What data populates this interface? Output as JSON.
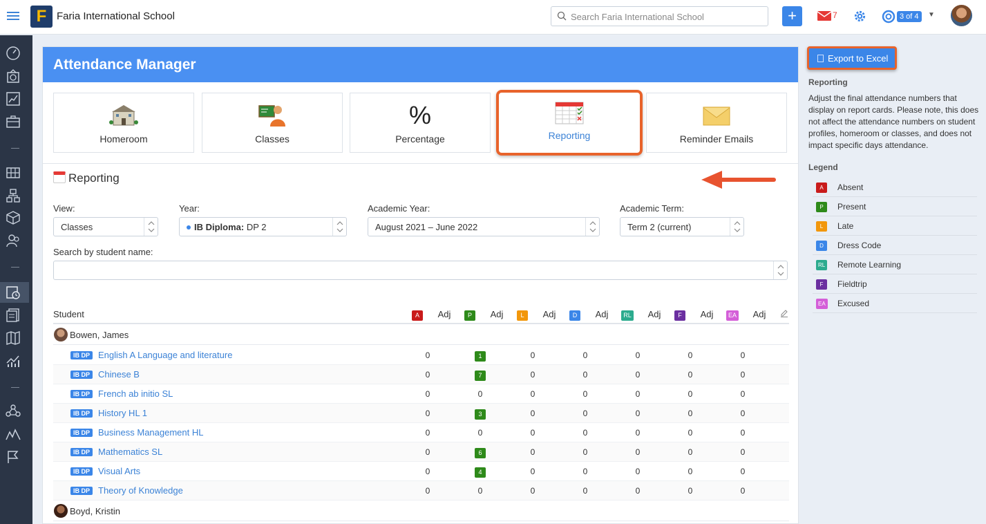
{
  "topbar": {
    "logo_letter": "F",
    "school_name": "Faria International School",
    "search_placeholder": "Search Faria International School",
    "mail_count": "7",
    "help_badge": "3 of 4"
  },
  "page": {
    "title": "Attendance Manager",
    "tiles": [
      {
        "label": "Homeroom",
        "icon": "school-building-icon"
      },
      {
        "label": "Classes",
        "icon": "teacher-board-icon"
      },
      {
        "label": "Percentage",
        "icon": "percent-icon",
        "glyph": "%"
      },
      {
        "label": "Reporting",
        "icon": "calendar-check-icon",
        "selected": true
      },
      {
        "label": "Reminder Emails",
        "icon": "envelope-icon"
      }
    ],
    "section_title": "Reporting"
  },
  "filters": {
    "view_label": "View:",
    "view_value": "Classes",
    "year_label": "Year:",
    "year_value_bold": "IB Diploma:",
    "year_value_rest": "DP 2",
    "academic_year_label": "Academic Year:",
    "academic_year_value": "August 2021 – June 2022",
    "academic_term_label": "Academic Term:",
    "academic_term_value": "Term 2 (current)",
    "search_label": "Search by student name:"
  },
  "table": {
    "student_header": "Student",
    "columns": [
      {
        "code": "A",
        "adj": "Adj"
      },
      {
        "code": "P",
        "adj": "Adj"
      },
      {
        "code": "L",
        "adj": "Adj"
      },
      {
        "code": "D",
        "adj": "Adj"
      },
      {
        "code": "RL",
        "adj": "Adj"
      },
      {
        "code": "F",
        "adj": "Adj"
      },
      {
        "code": "EA",
        "adj": "Adj"
      }
    ],
    "students": [
      {
        "name": "Bowen, James",
        "classes": [
          {
            "tag": "IB DP",
            "name": "English A Language and literature",
            "values": [
              "0",
              "1",
              "0",
              "0",
              "0",
              "0",
              "0"
            ]
          },
          {
            "tag": "IB DP",
            "name": "Chinese B",
            "values": [
              "0",
              "7",
              "0",
              "0",
              "0",
              "0",
              "0"
            ]
          },
          {
            "tag": "IB DP",
            "name": "French ab initio SL",
            "values": [
              "0",
              "0",
              "0",
              "0",
              "0",
              "0",
              "0"
            ]
          },
          {
            "tag": "IB DP",
            "name": "History HL 1",
            "values": [
              "0",
              "3",
              "0",
              "0",
              "0",
              "0",
              "0"
            ]
          },
          {
            "tag": "IB DP",
            "name": "Business Management HL",
            "values": [
              "0",
              "0",
              "0",
              "0",
              "0",
              "0",
              "0"
            ]
          },
          {
            "tag": "IB DP",
            "name": "Mathematics SL",
            "values": [
              "0",
              "6",
              "0",
              "0",
              "0",
              "0",
              "0"
            ]
          },
          {
            "tag": "IB DP",
            "name": "Visual Arts",
            "values": [
              "0",
              "4",
              "0",
              "0",
              "0",
              "0",
              "0"
            ]
          },
          {
            "tag": "IB DP",
            "name": "Theory of Knowledge",
            "values": [
              "0",
              "0",
              "0",
              "0",
              "0",
              "0",
              "0"
            ]
          }
        ]
      },
      {
        "name": "Boyd, Kristin",
        "classes": []
      }
    ]
  },
  "sidebar": {
    "export_label": "Export to Excel",
    "reporting_heading": "Reporting",
    "reporting_text": "Adjust the final attendance numbers that display on report cards. Please note, this does not affect the attendance numbers on student profiles, homeroom or classes, and does not impact specific days attendance.",
    "legend_heading": "Legend",
    "legend": [
      {
        "code": "A",
        "label": "Absent",
        "color": "#c91b1b"
      },
      {
        "code": "P",
        "label": "Present",
        "color": "#2e8a1a"
      },
      {
        "code": "L",
        "label": "Late",
        "color": "#f2970c"
      },
      {
        "code": "D",
        "label": "Dress Code",
        "color": "#3b86e8"
      },
      {
        "code": "RL",
        "label": "Remote Learning",
        "color": "#2cab8e"
      },
      {
        "code": "F",
        "label": "Fieldtrip",
        "color": "#6b2fa0"
      },
      {
        "code": "EA",
        "label": "Excused",
        "color": "#d45ed8"
      }
    ]
  },
  "nav_icons": [
    "dashboard-icon",
    "clock-icon",
    "chart-icon",
    "briefcase-icon",
    "grid-icon",
    "org-chart-icon",
    "cube-icon",
    "users-icon",
    "attendance-icon",
    "documents-icon",
    "map-icon",
    "analytics-icon",
    "network-icon",
    "mountains-icon",
    "flag-icon"
  ],
  "colors": {
    "accent": "#4a90f2",
    "highlight": "#e8632b",
    "link": "#3b82d6"
  }
}
